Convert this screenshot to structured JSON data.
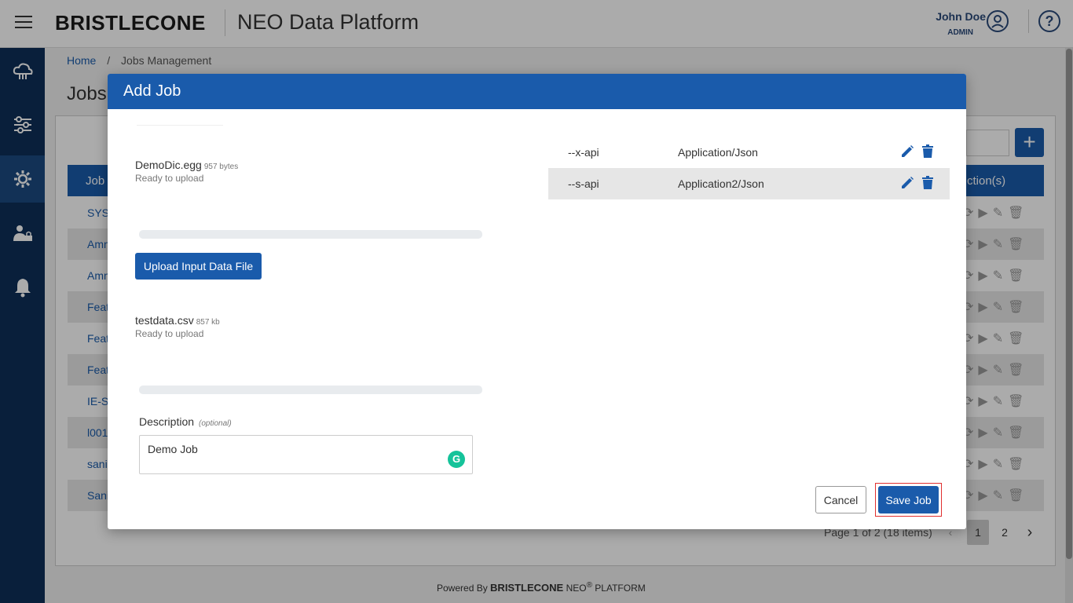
{
  "header": {
    "brand": "BRISTLECONE",
    "app_title": "NEO Data Platform",
    "user_name": "John Doe",
    "user_role": "ADMIN"
  },
  "breadcrumb": {
    "home": "Home",
    "separator": "/",
    "current": "Jobs Management"
  },
  "page_title": "Jobs",
  "table": {
    "col_job": "Job",
    "col_actions": "ction(s)",
    "rows": [
      "SYS-",
      "Amn",
      "Amn",
      "Feat",
      "Feat",
      "Feat",
      "IE-Si",
      "l001",
      "sani",
      "Sani"
    ]
  },
  "pagination": {
    "info": "Page 1 of 2 (18 items)",
    "page1": "1",
    "page2": "2"
  },
  "footer": {
    "powered": "Powered By",
    "brand": "BRISTLECONE",
    "neo": "NEO",
    "reg": "®",
    "platform": "PLATFORM"
  },
  "modal": {
    "title": "Add Job",
    "file1": {
      "name": "DemoDic.egg",
      "size": "957 bytes",
      "status": "Ready to upload"
    },
    "upload_button": "Upload Input Data File",
    "file2": {
      "name": "testdata.csv",
      "size": "857 kb",
      "status": "Ready to upload"
    },
    "description_label": "Description",
    "description_optional": "(optional)",
    "description_value": "Demo Job",
    "params": [
      {
        "key": "--x-api",
        "value": "Application/Json"
      },
      {
        "key": "--s-api",
        "value": "Application2/Json"
      }
    ],
    "cancel_label": "Cancel",
    "save_label": "Save Job"
  },
  "colors": {
    "primary": "#1a5bab",
    "sidebar": "#0e2f58",
    "highlight": "#e03030"
  },
  "icons": [
    "menu-icon",
    "user-icon",
    "help-icon",
    "cloud-icon",
    "filter-icon",
    "settings-icon",
    "user-lock-icon",
    "bell-icon",
    "edit-icon",
    "trash-icon",
    "grammarly-icon"
  ]
}
